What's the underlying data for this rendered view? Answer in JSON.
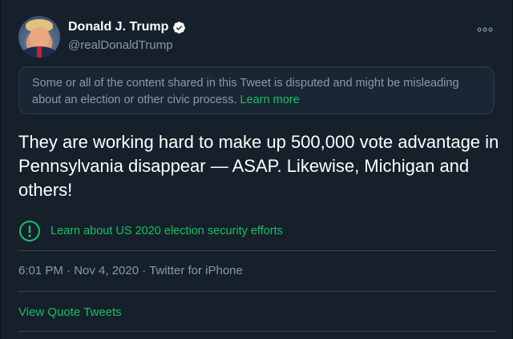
{
  "tweet": {
    "display_name": "Donald J. Trump",
    "handle": "@realDonaldTrump",
    "more_icon": "more-horizontal-icon",
    "verified_icon": "verified-badge-icon",
    "notice_text": "Some or all of the content shared in this Tweet is disputed and might be misleading about an election or other civic process.",
    "notice_link": "Learn more",
    "text": "They are working hard to make up 500,000 vote advantage in Pennsylvania disappear — ASAP. Likewise, Michigan and others!",
    "election_link": "Learn about US 2020 election security efforts",
    "election_icon": "exclamation-circle-icon",
    "meta": "6:01 PM · Nov 4, 2020 · Twitter for iPhone",
    "quote_tweets": "View Quote Tweets"
  },
  "colors": {
    "background": "#15202b",
    "text": "#ffffff",
    "secondary": "#8899a6",
    "green": "#17bf63",
    "border": "#38444d"
  }
}
